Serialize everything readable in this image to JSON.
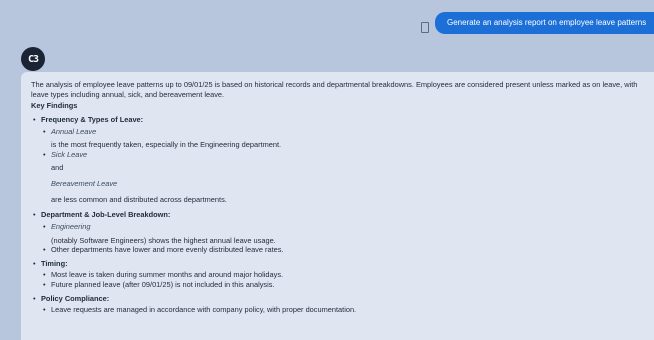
{
  "chat": {
    "user_message": "Generate an analysis report on employee leave patterns",
    "assistant_avatar": "C3"
  },
  "report": {
    "intro": "The analysis of employee leave patterns up to 09/01/25 is based on historical records and departmental breakdowns. Employees are considered present unless marked as on leave, with leave types including annual, sick, and bereavement leave.",
    "key_findings": "Key Findings",
    "sections": {
      "frequency": {
        "title": "Frequency & Types of Leave:",
        "annual_leave": "Annual Leave",
        "annual_desc": "is the most frequently taken, especially in the Engineering department.",
        "sick_leave": "Sick Leave",
        "and": "and",
        "bereavement_leave": "Bereavement Leave",
        "less_common": "are less common and distributed across departments."
      },
      "department": {
        "title": "Department & Job-Level Breakdown:",
        "engineering": "Engineering",
        "eng_desc": "(notably Software Engineers) shows the highest annual leave usage.",
        "other": "Other departments have lower and more evenly distributed leave rates."
      },
      "timing": {
        "title": "Timing:",
        "item1": "Most leave is taken during summer months and around major holidays.",
        "item2": "Future planned leave (after 09/01/25) is not included in this analysis."
      },
      "policy": {
        "title": "Policy Compliance:",
        "item1": "Leave requests are managed in accordance with company policy, with proper documentation."
      }
    }
  }
}
